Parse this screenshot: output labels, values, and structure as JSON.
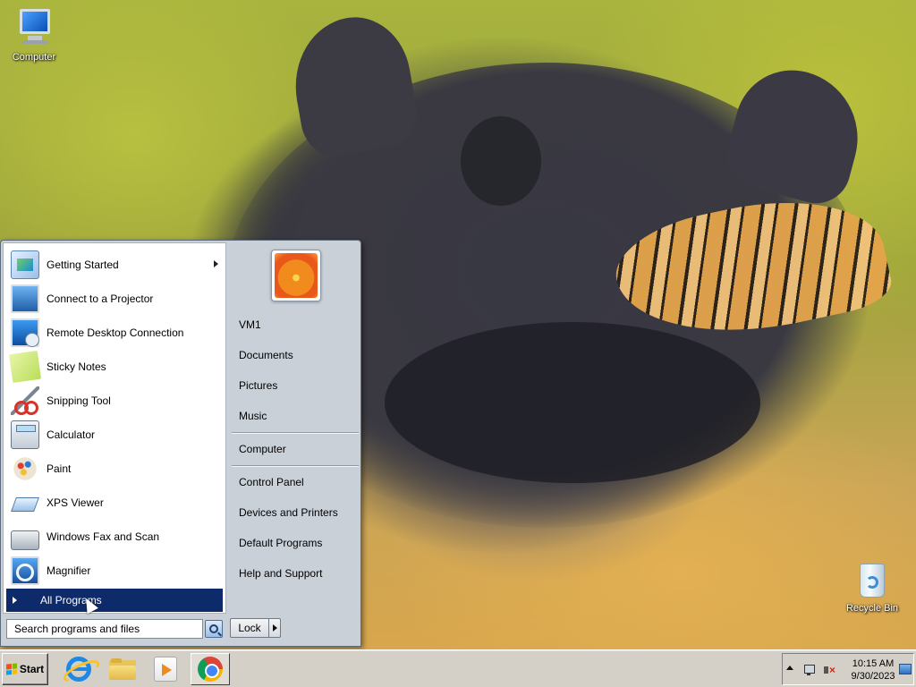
{
  "desktop": {
    "icons": [
      {
        "label": "Computer",
        "icon": "computer-icon"
      },
      {
        "label": "Recycle Bin",
        "icon": "recycle-bin-icon"
      }
    ]
  },
  "start_menu": {
    "programs": [
      {
        "label": "Getting Started",
        "icon": "getting-started-icon",
        "has_submenu": true
      },
      {
        "label": "Connect to a Projector",
        "icon": "projector-icon"
      },
      {
        "label": "Remote Desktop Connection",
        "icon": "remote-desktop-icon"
      },
      {
        "label": "Sticky Notes",
        "icon": "sticky-notes-icon"
      },
      {
        "label": "Snipping Tool",
        "icon": "scissors-icon"
      },
      {
        "label": "Calculator",
        "icon": "calculator-icon"
      },
      {
        "label": "Paint",
        "icon": "paint-palette-icon"
      },
      {
        "label": "XPS Viewer",
        "icon": "xps-viewer-icon"
      },
      {
        "label": "Windows Fax and Scan",
        "icon": "fax-icon"
      },
      {
        "label": "Magnifier",
        "icon": "magnifier-icon"
      }
    ],
    "all_programs_label": "All Programs",
    "search": {
      "placeholder": "Search programs and files"
    },
    "places": {
      "user": "VM1",
      "documents": "Documents",
      "pictures": "Pictures",
      "music": "Music",
      "computer": "Computer",
      "control_panel": "Control Panel",
      "devices_printers": "Devices and Printers",
      "default_programs": "Default Programs",
      "help_support": "Help and Support"
    },
    "lock_label": "Lock"
  },
  "taskbar": {
    "start_label": "Start",
    "pinned": [
      {
        "name": "Internet Explorer",
        "icon": "internet-explorer-icon"
      },
      {
        "name": "Windows Explorer",
        "icon": "folder-icon"
      },
      {
        "name": "Windows Media Player",
        "icon": "media-player-icon"
      },
      {
        "name": "Google Chrome",
        "icon": "chrome-icon"
      }
    ],
    "tray": {
      "time": "10:15 AM",
      "date": "9/30/2023"
    }
  },
  "colors": {
    "selection": "#0d2a6b",
    "menu_bg": "#c9d0d8",
    "taskbar_bg": "#d4d0c8"
  }
}
